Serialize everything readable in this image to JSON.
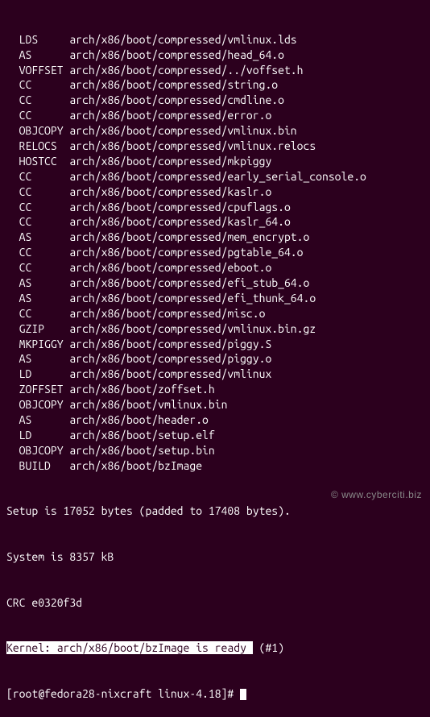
{
  "build_lines": [
    {
      "cmd": "LDS",
      "path": "arch/x86/boot/compressed/vmlinux.lds"
    },
    {
      "cmd": "AS",
      "path": "arch/x86/boot/compressed/head_64.o"
    },
    {
      "cmd": "VOFFSET",
      "path": "arch/x86/boot/compressed/../voffset.h"
    },
    {
      "cmd": "CC",
      "path": "arch/x86/boot/compressed/string.o"
    },
    {
      "cmd": "CC",
      "path": "arch/x86/boot/compressed/cmdline.o"
    },
    {
      "cmd": "CC",
      "path": "arch/x86/boot/compressed/error.o"
    },
    {
      "cmd": "OBJCOPY",
      "path": "arch/x86/boot/compressed/vmlinux.bin"
    },
    {
      "cmd": "RELOCS",
      "path": "arch/x86/boot/compressed/vmlinux.relocs"
    },
    {
      "cmd": "HOSTCC",
      "path": "arch/x86/boot/compressed/mkpiggy"
    },
    {
      "cmd": "CC",
      "path": "arch/x86/boot/compressed/early_serial_console.o"
    },
    {
      "cmd": "CC",
      "path": "arch/x86/boot/compressed/kaslr.o"
    },
    {
      "cmd": "CC",
      "path": "arch/x86/boot/compressed/cpuflags.o"
    },
    {
      "cmd": "CC",
      "path": "arch/x86/boot/compressed/kaslr_64.o"
    },
    {
      "cmd": "AS",
      "path": "arch/x86/boot/compressed/mem_encrypt.o"
    },
    {
      "cmd": "CC",
      "path": "arch/x86/boot/compressed/pgtable_64.o"
    },
    {
      "cmd": "CC",
      "path": "arch/x86/boot/compressed/eboot.o"
    },
    {
      "cmd": "AS",
      "path": "arch/x86/boot/compressed/efi_stub_64.o"
    },
    {
      "cmd": "AS",
      "path": "arch/x86/boot/compressed/efi_thunk_64.o"
    },
    {
      "cmd": "CC",
      "path": "arch/x86/boot/compressed/misc.o"
    },
    {
      "cmd": "GZIP",
      "path": "arch/x86/boot/compressed/vmlinux.bin.gz"
    },
    {
      "cmd": "MKPIGGY",
      "path": "arch/x86/boot/compressed/piggy.S"
    },
    {
      "cmd": "AS",
      "path": "arch/x86/boot/compressed/piggy.o"
    },
    {
      "cmd": "LD",
      "path": "arch/x86/boot/compressed/vmlinux"
    },
    {
      "cmd": "ZOFFSET",
      "path": "arch/x86/boot/zoffset.h"
    },
    {
      "cmd": "OBJCOPY",
      "path": "arch/x86/boot/vmlinux.bin"
    },
    {
      "cmd": "AS",
      "path": "arch/x86/boot/header.o"
    },
    {
      "cmd": "LD",
      "path": "arch/x86/boot/setup.elf"
    },
    {
      "cmd": "OBJCOPY",
      "path": "arch/x86/boot/setup.bin"
    },
    {
      "cmd": "BUILD",
      "path": "arch/x86/boot/bzImage"
    }
  ],
  "summary": {
    "setup": "Setup is 17052 bytes (padded to 17408 bytes).",
    "system": "System is 8357 kB",
    "crc": "CRC e0320f3d",
    "kernel_prefix": "Kernel: arch/x86/boot/bzImage is ready ",
    "kernel_suffix": " (#1)"
  },
  "prompt": "[root@fedora28-nixcraft linux-4.18]# ",
  "watermark": "© www.cyberciti.biz"
}
